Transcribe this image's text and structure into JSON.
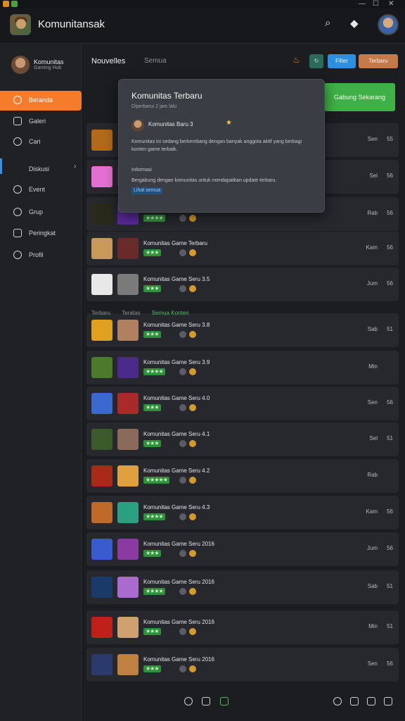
{
  "header": {
    "title": "Komunitansak"
  },
  "profile": {
    "name": "Komunitas",
    "subtitle": "Gaming Hub"
  },
  "sidebar": {
    "items": [
      {
        "label": "Beranda",
        "active": true,
        "icon": "home-icon"
      },
      {
        "label": "Galeri",
        "icon": "gallery-icon"
      },
      {
        "label": "Cari",
        "icon": "search-icon"
      },
      {
        "label": "Diskusi",
        "icon": "chat-icon"
      },
      {
        "label": "Event",
        "icon": "calendar-icon"
      },
      {
        "label": "Grup",
        "icon": "group-icon"
      },
      {
        "label": "Peringkat",
        "icon": "trophy-icon"
      },
      {
        "label": "Profil",
        "icon": "user-icon"
      }
    ]
  },
  "toolbar": {
    "tab_active": "Nouvelles",
    "tab_other": "Semua",
    "btn_blue": "Filter",
    "btn_orange": "Terbaru"
  },
  "popup": {
    "title": "Komunitas Terbaru",
    "subtitle": "Diperbarui 2 jam lalu",
    "user": "Komunitas Baru 3",
    "text": "Komunitas ini sedang berkembang dengan banyak anggota aktif yang berbagi konten game terbaik.",
    "label": "Informasi",
    "text2": "Bergabung dengan komunitas untuk mendapatkan update terbaru.",
    "link": "Lihat semua"
  },
  "big_button": "Gabung Sekarang",
  "section": {
    "a": "Terbaru",
    "b": "Teratas",
    "c": "Semua Konten"
  },
  "rows": [
    {
      "title": "",
      "meta": "Sen",
      "meta2": "55",
      "stars": "★★★",
      "colors": [
        "#b06a1a",
        "#2a2a2a"
      ]
    },
    {
      "title": "",
      "meta": "Sel",
      "meta2": "56",
      "stars": "★★★",
      "colors": [
        "#e36fd0",
        "#5a2a6a"
      ]
    },
    {
      "title": "",
      "meta": "Rab",
      "meta2": "56",
      "stars": "★★★★",
      "colors": [
        "#2a2a1a",
        "#5a2a9a"
      ]
    },
    {
      "title": "Komunitas Game Terbaru",
      "meta": "Kam",
      "meta2": "56",
      "stars": "★★★",
      "colors": [
        "#c79a5a",
        "#6a2a2a"
      ]
    },
    {
      "title": "Komunitas Game Seru 3.5",
      "meta": "Jum",
      "meta2": "56",
      "stars": "★★★",
      "colors": [
        "#e8e8e8",
        "#7a7a7a"
      ]
    },
    {
      "title": "Komunitas Game Seru 3.8",
      "meta": "Sab",
      "meta2": "51",
      "stars": "★★★",
      "colors": [
        "#e0a020",
        "#b08060"
      ]
    },
    {
      "title": "Komunitas Game Seru 3.9",
      "meta": "Min",
      "meta2": "",
      "stars": "★★★★",
      "colors": [
        "#4a7a2a",
        "#4a2a8a"
      ]
    },
    {
      "title": "Komunitas Game Seru 4.0",
      "meta": "Sen",
      "meta2": "56",
      "stars": "★★★",
      "colors": [
        "#3a6ad0",
        "#aa2a2a"
      ]
    },
    {
      "title": "Komunitas Game Seru 4.1",
      "meta": "Sel",
      "meta2": "51",
      "stars": "★★★",
      "colors": [
        "#3a5a2a",
        "#8a6a5a"
      ]
    },
    {
      "title": "Komunitas Game Seru 4.2",
      "meta": "Rab",
      "meta2": "",
      "stars": "★★★★★",
      "colors": [
        "#aa2a1a",
        "#e0a040"
      ]
    },
    {
      "title": "Komunitas Game Seru 4.3",
      "meta": "Kam",
      "meta2": "56",
      "stars": "★★★★",
      "colors": [
        "#c06a2a",
        "#2aa080"
      ]
    },
    {
      "title": "Komunitas Game Seru 2016",
      "meta": "Jum",
      "meta2": "56",
      "stars": "★★★",
      "colors": [
        "#3a5ad0",
        "#8a3aa0"
      ]
    },
    {
      "title": "Komunitas Game Seru 2016",
      "meta": "Sab",
      "meta2": "51",
      "stars": "★★★★",
      "colors": [
        "#1a3a6a",
        "#aa6ad0"
      ]
    },
    {
      "title": "Komunitas Game Seru 2016",
      "meta": "Min",
      "meta2": "51",
      "stars": "★★★",
      "colors": [
        "#c0201a",
        "#d0a070"
      ]
    },
    {
      "title": "Komunitas Game Seru 2016",
      "meta": "Sen",
      "meta2": "56",
      "stars": "★★★",
      "colors": [
        "#2a3a6a",
        "#c08040"
      ]
    }
  ]
}
